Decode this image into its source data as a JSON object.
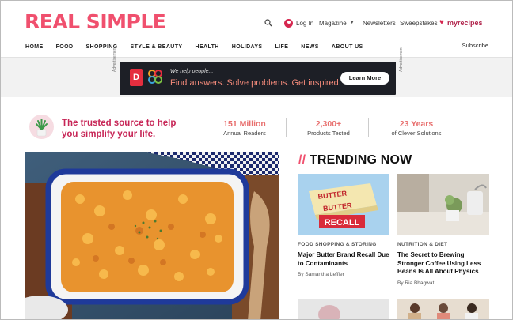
{
  "header": {
    "logo": "REAL SIMPLE",
    "login": "Log In",
    "magazine": "Magazine",
    "newsletters": "Newsletters",
    "sweepstakes": "Sweepstakes",
    "myrecipes": "myrecipes"
  },
  "nav": {
    "items": [
      "HOME",
      "FOOD",
      "SHOPPING",
      "STYLE & BEAUTY",
      "HEALTH",
      "HOLIDAYS",
      "LIFE",
      "NEWS",
      "ABOUT US"
    ],
    "subscribe": "Subscribe"
  },
  "ad": {
    "label": "Advertisement",
    "small_text": "We help people...",
    "parts": [
      "Find answers.",
      "Solve problems.",
      "Get inspired."
    ],
    "cta": "Learn More"
  },
  "tagline": "The trusted source to help you simplify your life.",
  "stats": [
    {
      "value": "151 Million",
      "label": "Annual Readers"
    },
    {
      "value": "2,300+",
      "label": "Products Tested"
    },
    {
      "value": "23 Years",
      "label": "of Clever Solutions"
    }
  ],
  "trending": {
    "slashes": "//",
    "heading": "TRENDING NOW",
    "cards": [
      {
        "category": "FOOD SHOPPING & STORING",
        "title": "Major Butter Brand Recall Due to Contaminants",
        "byline": "By Samantha Leffler",
        "img_text_1": "BUTTER",
        "img_text_2": "BUTTER",
        "img_text_3": "RECALL"
      },
      {
        "category": "NUTRITION & DIET",
        "title": "The Secret to Brewing Stronger Coffee Using Less Beans Is All About Physics",
        "byline": "By Ria Bhagwat"
      }
    ]
  },
  "colors": {
    "brand": "#f0506e",
    "tagline": "#c72556",
    "stat": "#e8706f"
  }
}
